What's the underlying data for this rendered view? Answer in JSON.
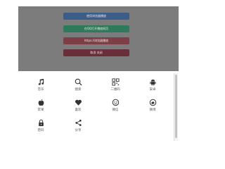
{
  "dialog": {
    "buttons": [
      {
        "label": "使用浏览器播放",
        "color": "#3c5d88"
      },
      {
        "label": "在QQ打开播放网页",
        "color": "#2f7a5a"
      },
      {
        "label": "https://浏览器播放",
        "color": "#7e3e45"
      },
      {
        "label": "取消 关闭",
        "color": "#6a2e3a"
      }
    ]
  },
  "share_sheet": {
    "items": [
      {
        "label": "音乐",
        "icon": "music-note-icon"
      },
      {
        "label": "搜索",
        "icon": "search-icon"
      },
      {
        "label": "二维码",
        "icon": "qr-code-icon"
      },
      {
        "label": "安卓",
        "icon": "android-icon"
      },
      {
        "label": "苹果",
        "icon": "apple-icon"
      },
      {
        "label": "喜欢",
        "icon": "heart-icon"
      },
      {
        "label": "微信",
        "icon": "wechat-icon"
      },
      {
        "label": "微博",
        "icon": "weibo-icon"
      },
      {
        "label": "密码",
        "icon": "lock-icon"
      },
      {
        "label": "分享",
        "icon": "share-icon"
      }
    ]
  }
}
